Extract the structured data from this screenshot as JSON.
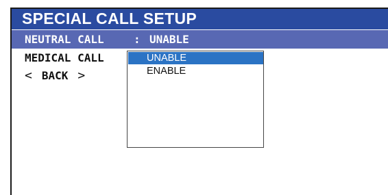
{
  "screen": {
    "title": "SPECIAL CALL SETUP"
  },
  "menu": {
    "neutral_call": {
      "label": "NEUTRAL CALL",
      "separator": ":",
      "value": "UNABLE"
    },
    "medical_call": {
      "label": "MEDICAL CALL"
    },
    "back": {
      "left_arrow": "<",
      "label": "BACK",
      "right_arrow": ">"
    }
  },
  "dropdown": {
    "options": [
      "UNABLE",
      "ENABLE"
    ],
    "highlighted": "UNABLE"
  },
  "colors": {
    "title_bar": "#2a4ba0",
    "selected_row": "#5868b3",
    "highlighted_option": "#2b73c4"
  }
}
